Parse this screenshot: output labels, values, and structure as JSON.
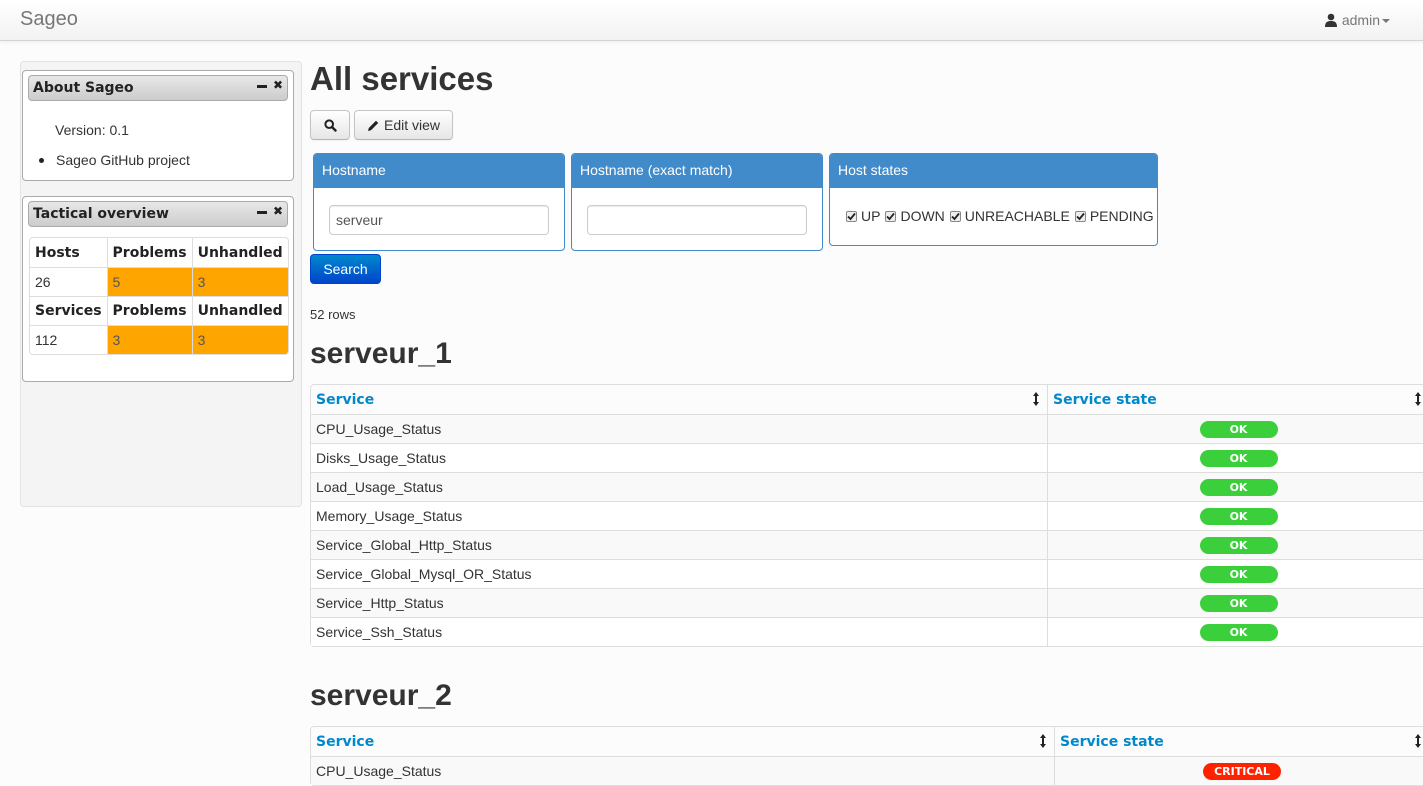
{
  "navbar": {
    "brand": "Sageo",
    "user": "admin",
    "user_icon": "user-icon"
  },
  "sidebar": {
    "about": {
      "title": "About Sageo",
      "version": "Version: 0.1",
      "link": "Sageo GitHub project"
    },
    "tactical": {
      "title": "Tactical overview",
      "hosts_header": [
        "Hosts",
        "Problems",
        "Unhandled"
      ],
      "hosts_values": [
        "26",
        "5",
        "3"
      ],
      "services_header": [
        "Services",
        "Problems",
        "Unhandled"
      ],
      "services_values": [
        "112",
        "3",
        "3"
      ],
      "warning_color": "#ffa500"
    }
  },
  "main": {
    "title": "All services",
    "toolbar": {
      "search_icon": "search-icon",
      "edit_view_label": "Edit view"
    },
    "filters": {
      "hostname": {
        "label": "Hostname",
        "value": "serveur"
      },
      "hostname_exact": {
        "label": "Hostname (exact match)",
        "value": ""
      },
      "host_states": {
        "label": "Host states",
        "options": [
          {
            "label": "UP",
            "checked": true
          },
          {
            "label": "DOWN",
            "checked": true
          },
          {
            "label": "UNREACHABLE",
            "checked": true
          },
          {
            "label": "PENDING",
            "checked": true
          }
        ]
      }
    },
    "search_button": "Search",
    "row_count": "52 rows",
    "columns": [
      "Service",
      "Service state"
    ],
    "hosts": [
      {
        "name": "serveur_1",
        "services": [
          {
            "service": "CPU_Usage_Status",
            "state": "OK"
          },
          {
            "service": "Disks_Usage_Status",
            "state": "OK"
          },
          {
            "service": "Load_Usage_Status",
            "state": "OK"
          },
          {
            "service": "Memory_Usage_Status",
            "state": "OK"
          },
          {
            "service": "Service_Global_Http_Status",
            "state": "OK"
          },
          {
            "service": "Service_Global_Mysql_OR_Status",
            "state": "OK"
          },
          {
            "service": "Service_Http_Status",
            "state": "OK"
          },
          {
            "service": "Service_Ssh_Status",
            "state": "OK"
          }
        ]
      },
      {
        "name": "serveur_2",
        "services": [
          {
            "service": "CPU_Usage_Status",
            "state": "CRITICAL"
          }
        ]
      }
    ],
    "state_colors": {
      "OK": "#3ccf3c",
      "CRITICAL": "#ff2200"
    },
    "accent_color": "#428bca",
    "link_color": "#0088cc"
  }
}
